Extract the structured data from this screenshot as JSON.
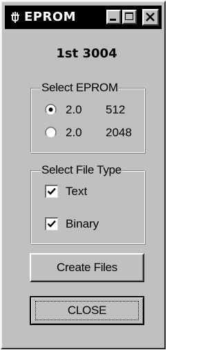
{
  "window": {
    "title": "EPROM",
    "title_icon": "plug-icon",
    "buttons": [
      "minimize-icon",
      "maximize-icon",
      "close-icon"
    ]
  },
  "heading": "1st 3004",
  "eprom_group": {
    "label": "Select EPROM",
    "options": [
      {
        "version": "2.0",
        "size": "512",
        "selected": true
      },
      {
        "version": "2.0",
        "size": "2048",
        "selected": false
      }
    ]
  },
  "file_type_group": {
    "label": "Select File Type",
    "options": [
      {
        "label": "Text",
        "checked": true
      },
      {
        "label": "Binary",
        "checked": true
      }
    ]
  },
  "buttons": {
    "create_label": "Create Files",
    "close_label": "CLOSE"
  },
  "colors": {
    "face": "#c0c0c0",
    "titlebar": "#000000",
    "title_text": "#ffffff"
  }
}
